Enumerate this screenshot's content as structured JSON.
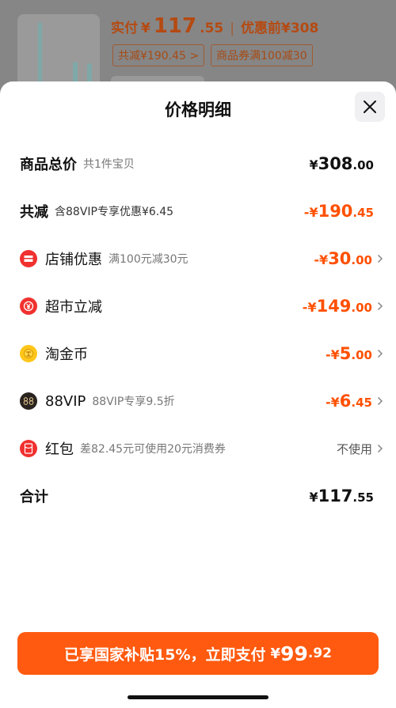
{
  "background": {
    "price_label": "实付",
    "price_currency": "¥",
    "price_int": "117",
    "price_dec": ".55",
    "separator": "|",
    "original_label": "优惠前¥308",
    "tags": [
      "共减¥190.45 >",
      "商品券满100减30"
    ]
  },
  "sheet": {
    "title": "价格明细",
    "close_icon": "close-icon"
  },
  "rows": {
    "total": {
      "label": "商品总价",
      "sub": "共1件宝贝",
      "currency": "¥",
      "int": "308",
      "dec": ".00"
    },
    "reduction": {
      "label": "共减",
      "sub": "含88VIP专享优惠¥6.45",
      "currency": "-¥",
      "int": "190",
      "dec": ".45"
    },
    "store": {
      "label": "店铺优惠",
      "sub": "满100元减30元",
      "currency": "-¥",
      "int": "30",
      "dec": ".00",
      "icon": "store-coupon-icon"
    },
    "market": {
      "label": "超市立减",
      "sub": "",
      "currency": "-¥",
      "int": "149",
      "dec": ".00",
      "icon": "supermarket-icon"
    },
    "coin": {
      "label": "淘金币",
      "sub": "",
      "currency": "-¥",
      "int": "5",
      "dec": ".00",
      "icon": "gold-coin-icon"
    },
    "vip": {
      "label": "88VIP",
      "sub": "88VIP专享9.5折",
      "currency": "-¥",
      "int": "6",
      "dec": ".45",
      "icon": "88vip-icon"
    },
    "redpacket": {
      "label": "红包",
      "sub": "差82.45元可使用20元消费券",
      "value": "不使用",
      "icon": "red-packet-icon"
    },
    "sum": {
      "label": "合计",
      "currency": "¥",
      "int": "117",
      "dec": ".55"
    }
  },
  "pay_button": {
    "text": "已享国家补贴15%，立即支付",
    "currency": "¥",
    "int": "99",
    "dec": ".92"
  },
  "colors": {
    "accent": "#ff5000",
    "button": "#ff5a0f",
    "text": "#111111",
    "muted": "#777777"
  }
}
